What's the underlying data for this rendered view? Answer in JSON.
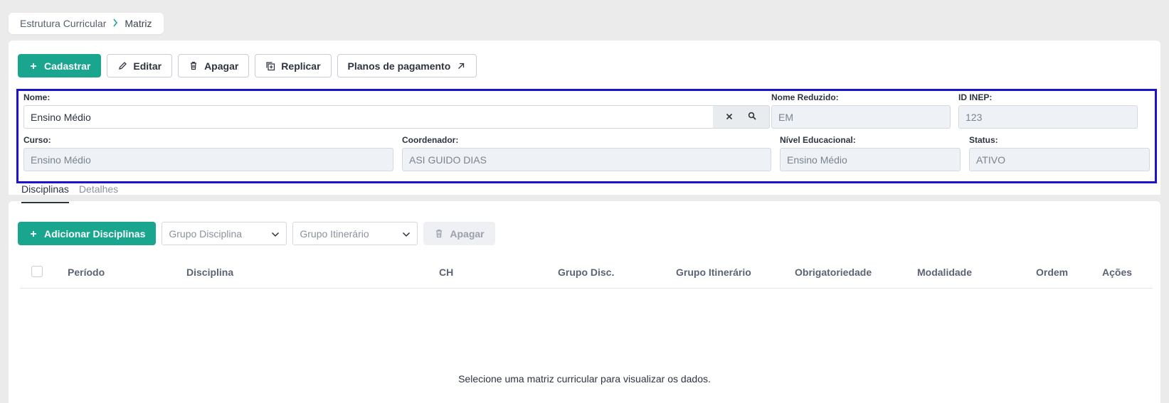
{
  "breadcrumb": {
    "parent": "Estrutura Curricular",
    "current": "Matriz"
  },
  "toolbar": {
    "cadastrar": "Cadastrar",
    "editar": "Editar",
    "apagar": "Apagar",
    "replicar": "Replicar",
    "planos": "Planos de pagamento"
  },
  "form": {
    "nome": {
      "label": "Nome:",
      "value": "Ensino Médio"
    },
    "nome_reduzido": {
      "label": "Nome Reduzido:",
      "value": "EM"
    },
    "id_inep": {
      "label": "ID INEP:",
      "value": "123"
    },
    "curso": {
      "label": "Curso:",
      "value": "Ensino Médio"
    },
    "coordenador": {
      "label": "Coordenador:",
      "value": "ASI GUIDO DIAS"
    },
    "nivel": {
      "label": "Nível Educacional:",
      "value": "Ensino Médio"
    },
    "status": {
      "label": "Status:",
      "value": "ATIVO"
    }
  },
  "tabs": [
    {
      "label": "Disciplinas"
    },
    {
      "label": "Detalhes"
    }
  ],
  "disciplinas_toolbar": {
    "adicionar": "Adicionar Disciplinas",
    "grupo_disciplina": "Grupo Disciplina",
    "grupo_itinerario": "Grupo Itinerário",
    "apagar": "Apagar"
  },
  "table": {
    "columns": [
      "Período",
      "Disciplina",
      "CH",
      "Grupo Disc.",
      "Grupo Itinerário",
      "Obrigatoriedade",
      "Modalidade",
      "Ordem",
      "Ações"
    ],
    "empty_message": "Selecione uma matriz curricular para visualizar os dados."
  },
  "colors": {
    "primary": "#1aa68e",
    "highlight_border": "#1c13d1"
  }
}
